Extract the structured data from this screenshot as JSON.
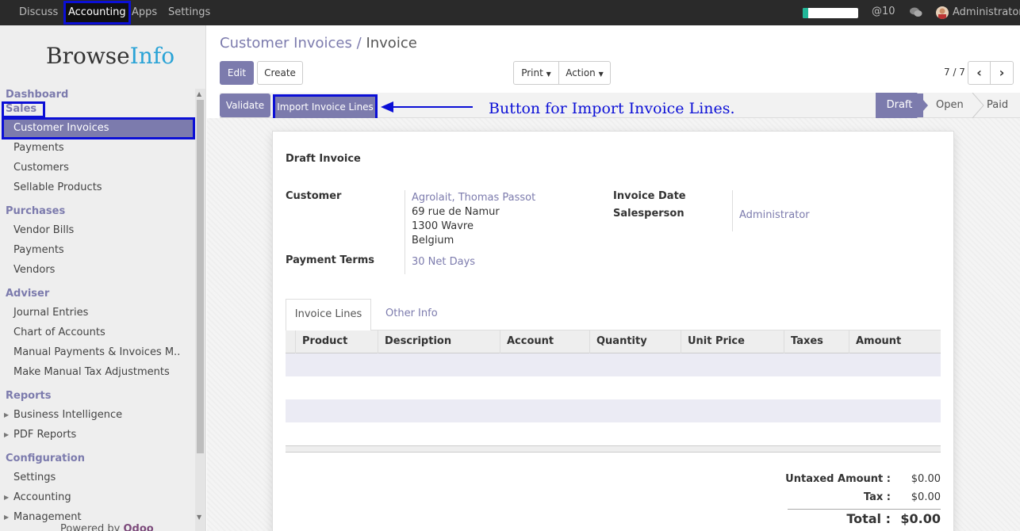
{
  "topbar": {
    "menus": [
      "Discuss",
      "Accounting",
      "Apps",
      "Settings"
    ],
    "progress": 0.1,
    "mentions": "@10",
    "user": "Administrator",
    "accent": "#0b0fd6"
  },
  "sidebar": {
    "logo_a": "Browse",
    "logo_b": "Info",
    "sections": {
      "dashboard": "Dashboard",
      "sales": "Sales",
      "purchases": "Purchases",
      "adviser": "Adviser",
      "reports": "Reports",
      "configuration": "Configuration"
    },
    "sales_items": [
      "Customer Invoices",
      "Payments",
      "Customers",
      "Sellable Products"
    ],
    "purchase_items": [
      "Vendor Bills",
      "Payments",
      "Vendors"
    ],
    "adviser_items": [
      "Journal Entries",
      "Chart of Accounts",
      "Manual Payments & Invoices M..",
      "Make Manual Tax Adjustments"
    ],
    "report_items": [
      "Business Intelligence",
      "PDF Reports"
    ],
    "config_items": [
      "Settings",
      "Accounting",
      "Management"
    ],
    "powered_prefix": "Powered by",
    "powered_brand": "Odoo"
  },
  "header": {
    "crumb_parent": "Customer Invoices",
    "crumb_sep": "/",
    "crumb_current": "Invoice",
    "edit": "Edit",
    "create": "Create",
    "print": "Print",
    "action": "Action",
    "pager": "7 / 7"
  },
  "statusbar": {
    "validate": "Validate",
    "import": "Import Invoice Lines",
    "annotation": "Button for Import Invoice Lines.",
    "stages": [
      "Draft",
      "Open",
      "Paid"
    ]
  },
  "form": {
    "title": "Draft Invoice",
    "customer_label": "Customer",
    "customer_name": "Agrolait, Thomas Passot",
    "address": [
      "69 rue de Namur",
      "1300 Wavre",
      "Belgium"
    ],
    "terms_label": "Payment Terms",
    "terms_value": "30 Net Days",
    "date_label": "Invoice Date",
    "salesperson_label": "Salesperson",
    "salesperson_value": "Administrator"
  },
  "tabs": [
    "Invoice Lines",
    "Other Info"
  ],
  "table": {
    "columns": [
      "Product",
      "Description",
      "Account",
      "Quantity",
      "Unit Price",
      "Taxes",
      "Amount"
    ]
  },
  "totals": {
    "untaxed_label": "Untaxed Amount :",
    "untaxed_value": "$0.00",
    "tax_label": "Tax :",
    "tax_value": "$0.00",
    "total_label": "Total :",
    "total_value": "$0.00"
  }
}
